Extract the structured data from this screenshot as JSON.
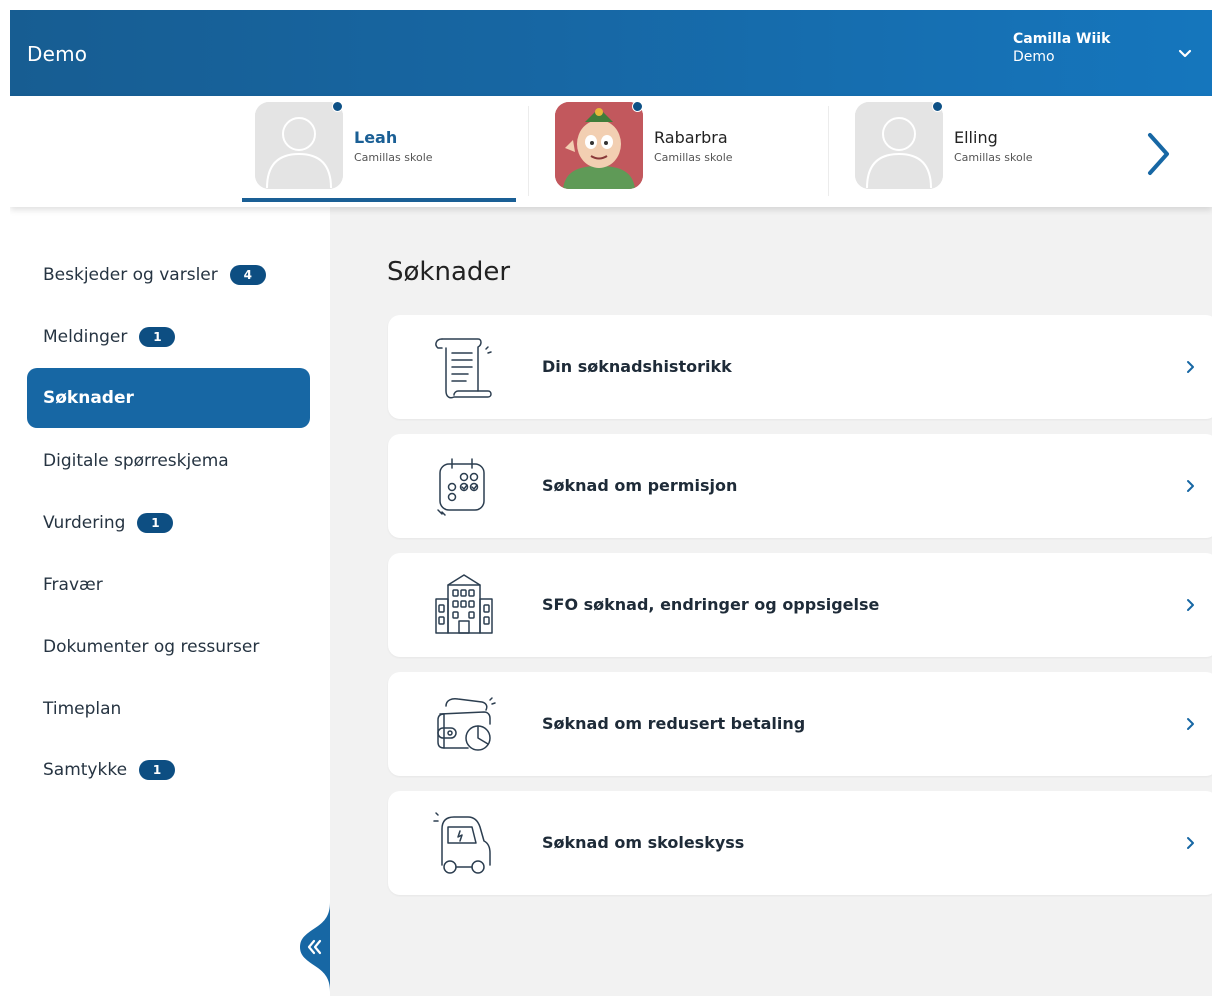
{
  "header": {
    "app_title": "Demo",
    "user_name": "Camilla Wiik",
    "user_sub": "Demo"
  },
  "children": [
    {
      "name": "Leah",
      "school": "Camillas skole",
      "active": true
    },
    {
      "name": "Rabarbra",
      "school": "Camillas skole",
      "active": false
    },
    {
      "name": "Elling",
      "school": "Camillas skole",
      "active": false
    }
  ],
  "sidebar": {
    "items": [
      {
        "label": "Beskjeder og varsler",
        "badge": "4"
      },
      {
        "label": "Meldinger",
        "badge": "1"
      },
      {
        "label": "Søknader",
        "badge": null,
        "active": true
      },
      {
        "label": "Digitale spørreskjema",
        "badge": null
      },
      {
        "label": "Vurdering",
        "badge": "1"
      },
      {
        "label": "Fravær",
        "badge": null
      },
      {
        "label": "Dokumenter og ressurser",
        "badge": null
      },
      {
        "label": "Timeplan",
        "badge": null
      },
      {
        "label": "Samtykke",
        "badge": "1"
      }
    ]
  },
  "main": {
    "title": "Søknader",
    "cards": [
      {
        "label": "Din søknadshistorikk",
        "icon": "scroll-icon"
      },
      {
        "label": "Søknad om permisjon",
        "icon": "calendar-check-icon"
      },
      {
        "label": "SFO søknad, endringer og oppsigelse",
        "icon": "school-building-icon"
      },
      {
        "label": "Søknad om redusert betaling",
        "icon": "wallet-coins-icon"
      },
      {
        "label": "Søknad om skoleskyss",
        "icon": "car-icon"
      }
    ]
  },
  "colors": {
    "header": "#1767a4",
    "accent": "#1767a4",
    "badge": "#0d4e82",
    "main_bg": "#f2f2f2"
  }
}
